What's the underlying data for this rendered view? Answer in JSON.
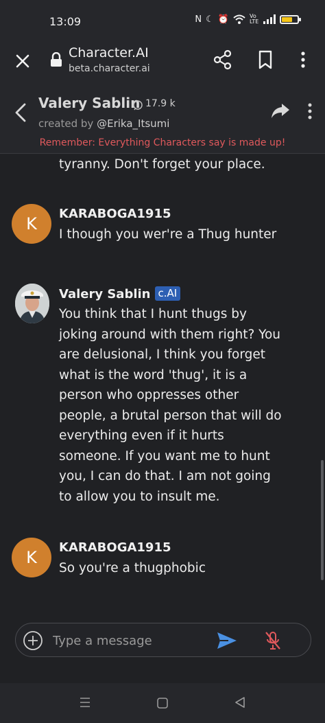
{
  "status_bar": {
    "time": "13:09",
    "network_label": "Vo LTE",
    "battery_percent": 70
  },
  "browser": {
    "title": "Character.AI",
    "url": "beta.character.ai"
  },
  "chat_header": {
    "character_name": "Valery Sablin",
    "interaction_count": "17.9 k",
    "created_by_prefix": "created by",
    "creator": "@Erika_Itsumi",
    "disclaimer": "Remember: Everything Characters say is made up!"
  },
  "messages": [
    {
      "sender": "",
      "text": "tyranny. Don't forget your place."
    },
    {
      "sender": "KARABOGA1915",
      "avatar_letter": "K",
      "text": "I though you wer're a Thug hunter"
    },
    {
      "sender": "Valery Sablin",
      "badge": "c.AI",
      "text": "You think that I hunt thugs by joking around with them right? You are delusional, I think you forget what is the word 'thug', it is a person who oppresses other people, a brutal person that will do everything even if it hurts someone. If you want me to hunt you, I can do that. I am not going to allow you to insult me."
    },
    {
      "sender": "KARABOGA1915",
      "avatar_letter": "K",
      "text": "So you're a thugphobic"
    }
  ],
  "composer": {
    "placeholder": "Type a message"
  },
  "colors": {
    "background": "#202124",
    "avatar_user": "#d0802d",
    "badge": "#2d5fb3",
    "disclaimer": "#e0595c",
    "send": "#4a90e2",
    "mic_off": "#e0595c"
  }
}
